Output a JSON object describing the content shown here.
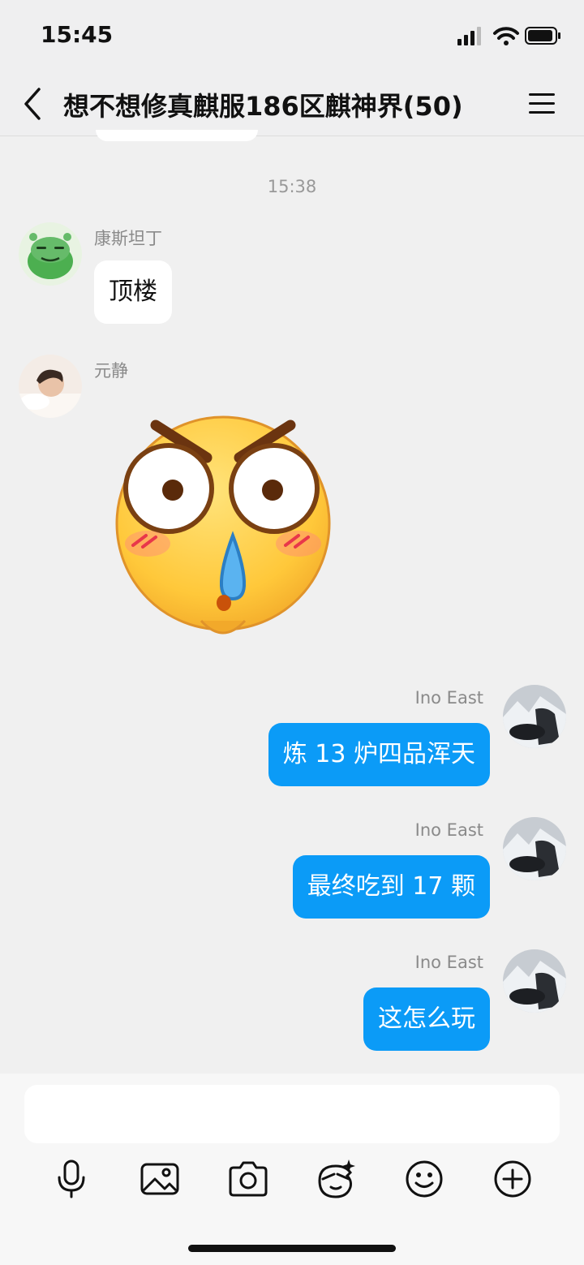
{
  "status": {
    "time": "15:45"
  },
  "header": {
    "title": "想不想修真麒服186区麒神界(50)"
  },
  "chat": {
    "timestamp": "15:38",
    "messages": [
      {
        "sender": "康斯坦丁",
        "text": "顶楼",
        "direction": "incoming"
      },
      {
        "sender": "元静",
        "sticker": "angry-shocked-face-sticker",
        "direction": "incoming"
      },
      {
        "sender": "Ino East",
        "text": "炼 13 炉四品浑天",
        "direction": "outgoing"
      },
      {
        "sender": "Ino East",
        "text": "最终吃到 17 颗",
        "direction": "outgoing"
      },
      {
        "sender": "Ino East",
        "text": "这怎么玩",
        "direction": "outgoing"
      }
    ]
  },
  "input": {
    "value": ""
  },
  "toolbar": {
    "icons": [
      "microphone-icon",
      "image-icon",
      "camera-icon",
      "sticker-face-icon",
      "emoji-icon",
      "plus-icon"
    ]
  },
  "colors": {
    "outgoing_bubble": "#0b9bf7",
    "background": "#f0f0f0"
  }
}
